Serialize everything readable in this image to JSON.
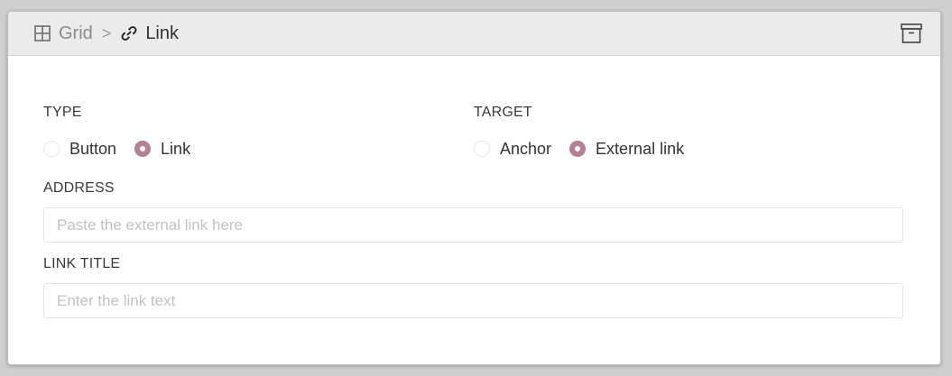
{
  "breadcrumb": {
    "parent": {
      "label": "Grid",
      "icon": "grid-icon"
    },
    "separator": ">",
    "current": {
      "label": "Link",
      "icon": "link-icon"
    }
  },
  "header_actions": {
    "archive_icon": "archive-icon"
  },
  "type_field": {
    "label": "TYPE",
    "options": [
      {
        "label": "Button",
        "checked": false
      },
      {
        "label": "Link",
        "checked": true
      }
    ]
  },
  "target_field": {
    "label": "TARGET",
    "options": [
      {
        "label": "Anchor",
        "checked": false
      },
      {
        "label": "External link",
        "checked": true
      }
    ]
  },
  "address_field": {
    "label": "ADDRESS",
    "value": "",
    "placeholder": "Paste the external link here"
  },
  "link_title_field": {
    "label": "LINK TITLE",
    "value": "",
    "placeholder": "Enter the link text"
  },
  "colors": {
    "accent": "#b57f94",
    "header_bg": "#ebebeb"
  }
}
